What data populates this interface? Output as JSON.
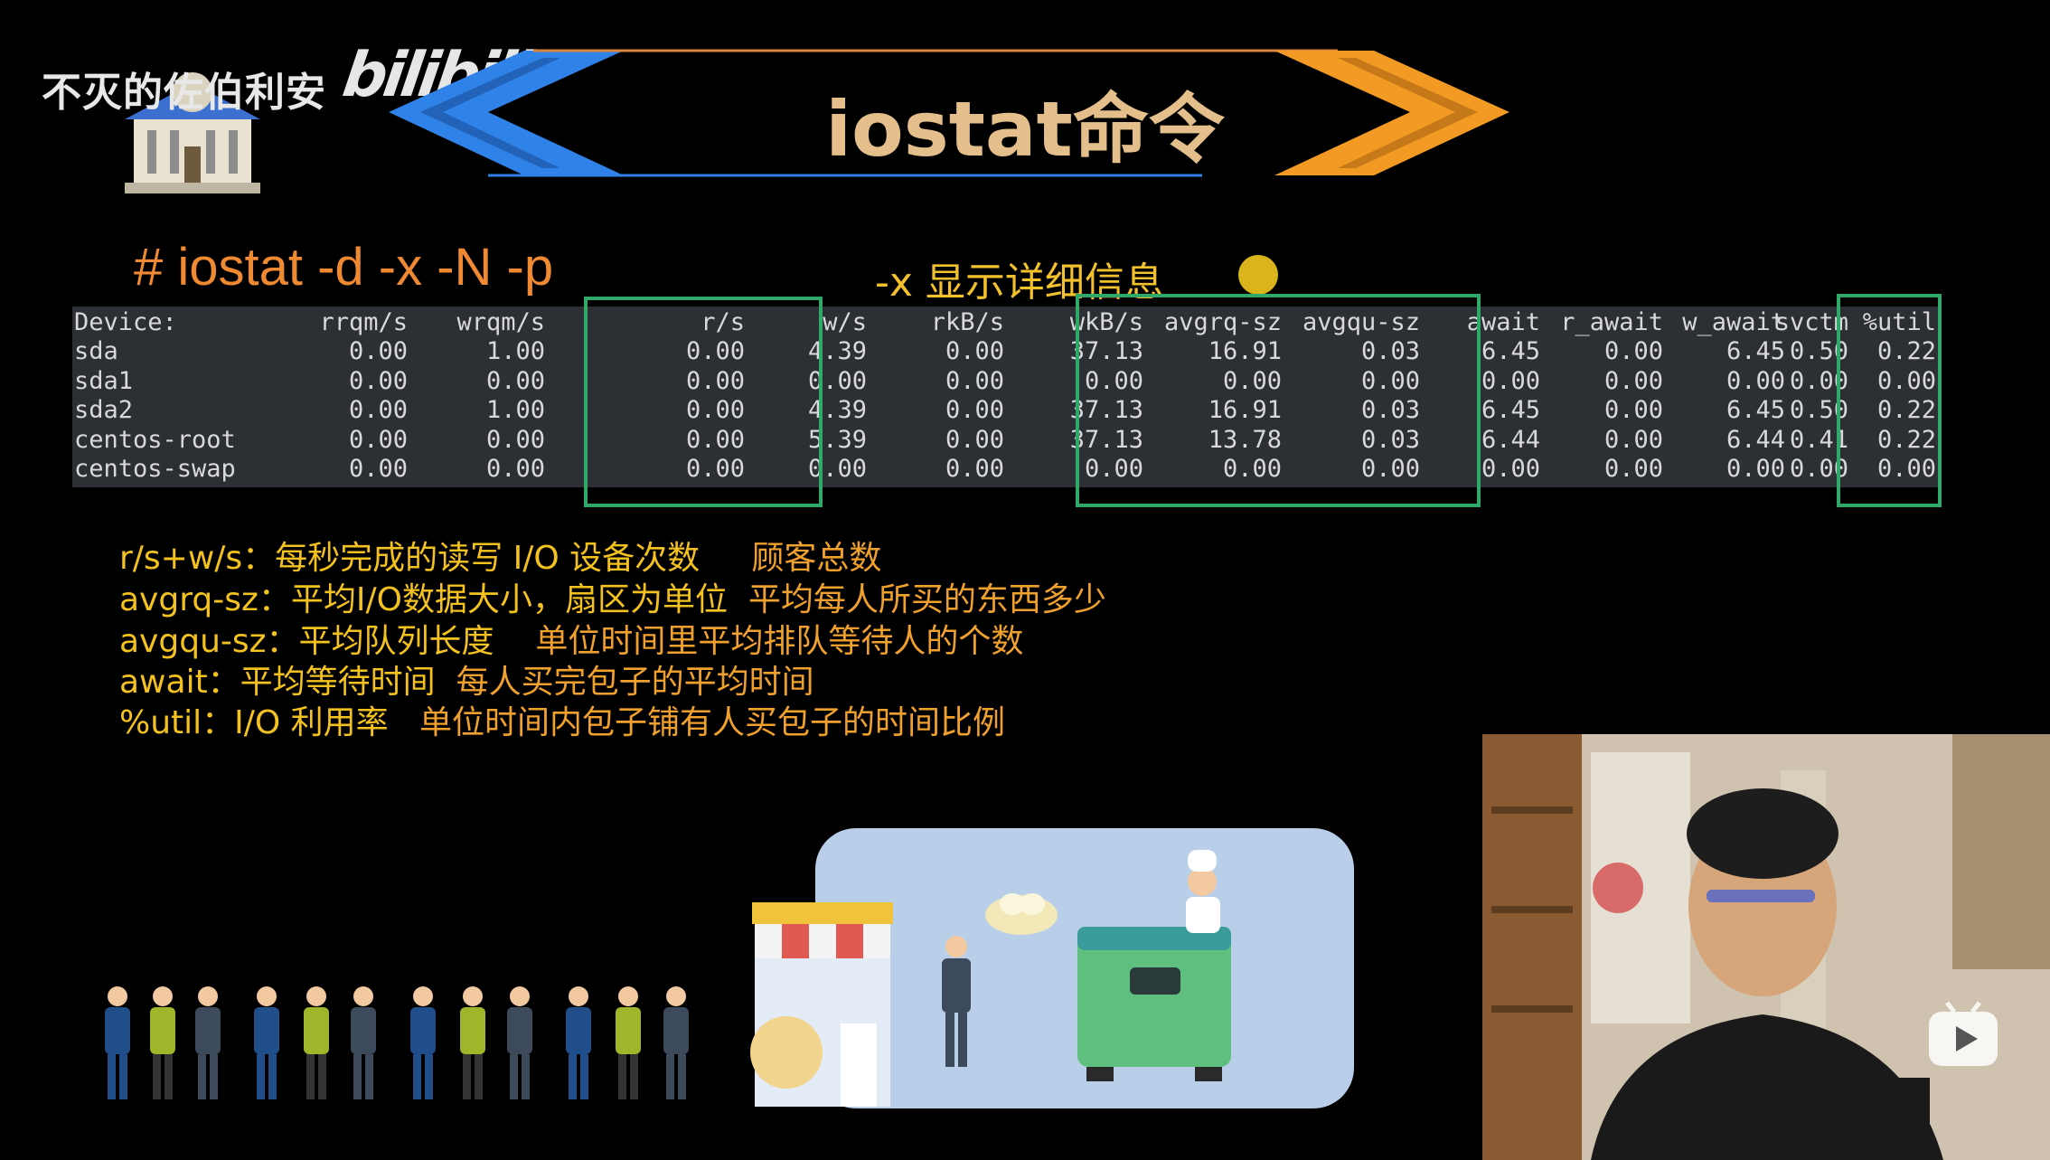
{
  "watermark": {
    "channel": "不灭的佐伯利安",
    "brand": "bilibili"
  },
  "slide": {
    "title": "iostat命令",
    "command": "#  iostat  -d -x -N -p",
    "command_desc": "-x 显示详细信息"
  },
  "table": {
    "headers": [
      "Device:",
      "rrqm/s",
      "wrqm/s",
      "r/s",
      "w/s",
      "rkB/s",
      "wkB/s",
      "avgrq-sz",
      "avgqu-sz",
      "await",
      "r_await",
      "w_await",
      "svctm",
      "%util"
    ],
    "rows": [
      [
        "sda",
        "0.00",
        "1.00",
        "0.00",
        "4.39",
        "0.00",
        "37.13",
        "16.91",
        "0.03",
        "6.45",
        "0.00",
        "6.45",
        "0.50",
        "0.22"
      ],
      [
        "sda1",
        "0.00",
        "0.00",
        "0.00",
        "0.00",
        "0.00",
        "0.00",
        "0.00",
        "0.00",
        "0.00",
        "0.00",
        "0.00",
        "0.00",
        "0.00"
      ],
      [
        "sda2",
        "0.00",
        "1.00",
        "0.00",
        "4.39",
        "0.00",
        "37.13",
        "16.91",
        "0.03",
        "6.45",
        "0.00",
        "6.45",
        "0.50",
        "0.22"
      ],
      [
        "centos-root",
        "0.00",
        "0.00",
        "0.00",
        "5.39",
        "0.00",
        "37.13",
        "13.78",
        "0.03",
        "6.44",
        "0.00",
        "6.44",
        "0.41",
        "0.22"
      ],
      [
        "centos-swap",
        "0.00",
        "0.00",
        "0.00",
        "0.00",
        "0.00",
        "0.00",
        "0.00",
        "0.00",
        "0.00",
        "0.00",
        "0.00",
        "0.00",
        "0.00"
      ]
    ]
  },
  "explanations": [
    {
      "term": "r/s+w/s：每秒完成的读写 I/O 设备次数",
      "analogy": "顾客总数"
    },
    {
      "term": "avgrq-sz：平均I/O数据大小，扇区为单位",
      "analogy": "平均每人所买的东西多少"
    },
    {
      "term": "avgqu-sz：平均队列长度",
      "analogy": "单位时间里平均排队等待人的个数"
    },
    {
      "term": "await：平均等待时间",
      "analogy": "每人买完包子的平均时间"
    },
    {
      "term": "%util：I/O 利用率",
      "analogy": "单位时间内包子铺有人买包子的时间比例"
    }
  ],
  "colors": {
    "accent_orange": "#f08a32",
    "explain_yellow": "#f4c21f",
    "box_green": "#2fa86a",
    "title_gold": "#e4bf8c"
  },
  "icons": [
    "building-icon",
    "bilibili-logo",
    "play-icon",
    "shop-icon",
    "steamer-icon",
    "chef-icon",
    "person-icon"
  ]
}
